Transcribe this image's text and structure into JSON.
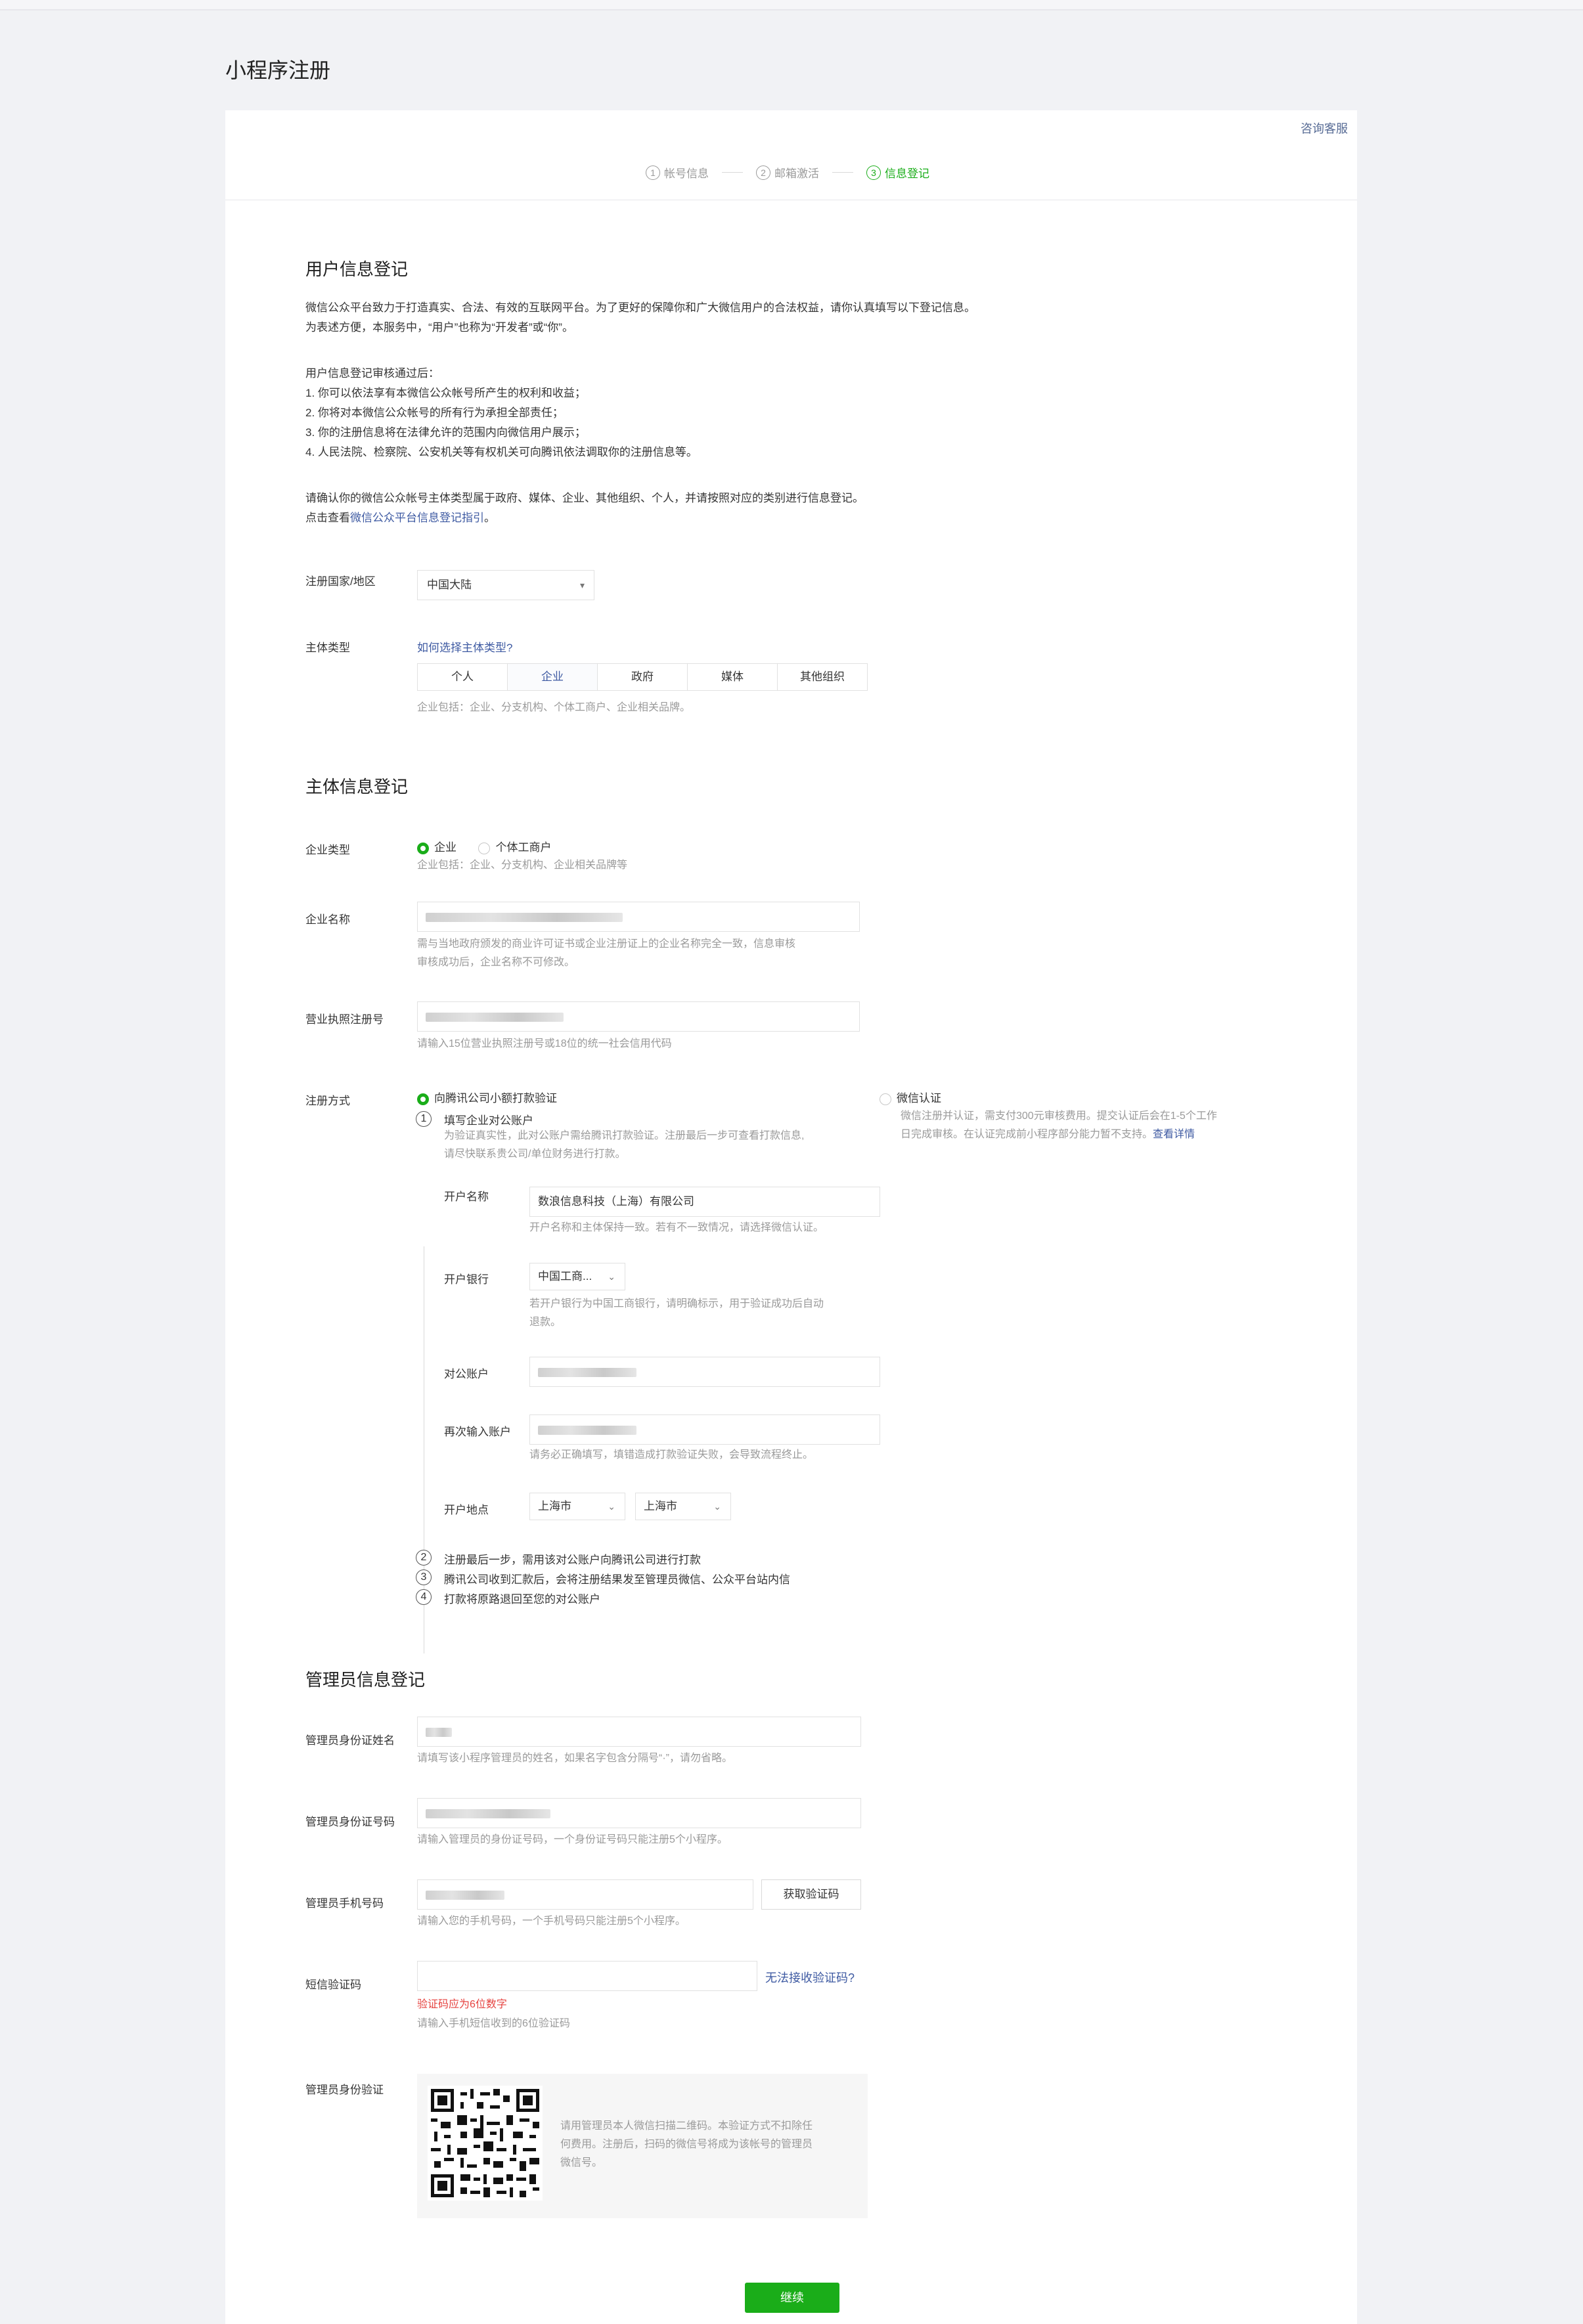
{
  "page_title": "小程序注册",
  "help_link": "咨询客服",
  "steps": [
    {
      "num": "1",
      "label": "帐号信息"
    },
    {
      "num": "2",
      "label": "邮箱激活"
    },
    {
      "num": "3",
      "label": "信息登记"
    }
  ],
  "user_info": {
    "title": "用户信息登记",
    "intro_1": "微信公众平台致力于打造真实、合法、有效的互联网平台。为了更好的保障你和广大微信用户的合法权益，请你认真填写以下登记信息。",
    "intro_2": "为表述方便，本服务中，“用户”也称为“开发者”或“你”。",
    "after_title": "用户信息登记审核通过后：",
    "after_items": [
      "1. 你可以依法享有本微信公众帐号所产生的权利和收益；",
      "2. 你将对本微信公众帐号的所有行为承担全部责任；",
      "3. 你的注册信息将在法律允许的范围内向微信用户展示；",
      "4. 人民法院、检察院、公安机关等有权机关可向腾讯依法调取你的注册信息等。"
    ],
    "confirm_text": "请确认你的微信公众帐号主体类型属于政府、媒体、企业、其他组织、个人，并请按照对应的类别进行信息登记。",
    "guide_prefix": "点击查看",
    "guide_link": "微信公众平台信息登记指引",
    "guide_suffix": "。",
    "country_label": "注册国家/地区",
    "country_value": "中国大陆",
    "subject_label": "主体类型",
    "subject_help": "如何选择主体类型?",
    "subject_types": [
      "个人",
      "企业",
      "政府",
      "媒体",
      "其他组织"
    ],
    "subject_hint": "企业包括：企业、分支机构、个体工商户、企业相关品牌。"
  },
  "subject_info": {
    "title": "主体信息登记",
    "company_type_label": "企业类型",
    "company_type_opt1": "企业",
    "company_type_opt2": "个体工商户",
    "company_type_hint": "企业包括：企业、分支机构、企业相关品牌等",
    "company_name_label": "企业名称",
    "company_name_hint_1": "需与当地政府颁发的商业许可证书或企业注册证上的企业名称完全一致，信息审核",
    "company_name_hint_2": "审核成功后，企业名称不可修改。",
    "license_label": "营业执照注册号",
    "license_hint": "请输入15位营业执照注册号或18位的统一社会信用代码",
    "reg_method_label": "注册方式",
    "method1": "向腾讯公司小额打款验证",
    "method2": "微信认证",
    "method2_desc_1": "微信注册并认证，需支付300元审核费用。提交认证后会在1-5个工作",
    "method2_desc_2": "日完成审核。在认证完成前小程序部分能力暂不支持。",
    "method2_link": "查看详情",
    "step1_num": "1",
    "step1_title": "填写企业对公账户",
    "step1_desc_1": "为验证真实性，此对公账户需给腾讯打款验证。注册最后一步可查看打款信息,",
    "step1_desc_2": "请尽快联系贵公司/单位财务进行打款。",
    "account_name_label": "开户名称",
    "account_name_value": "数浪信息科技（上海）有限公司",
    "account_name_hint": "开户名称和主体保持一致。若有不一致情况，请选择微信认证。",
    "bank_label": "开户银行",
    "bank_value": "中国工商...",
    "bank_hint_1": "若开户银行为中国工商银行，请明确标示，用于验证成功后自动",
    "bank_hint_2": "退款。",
    "account_label": "对公账户",
    "account_repeat_label": "再次输入账户",
    "account_repeat_hint": "请务必正确填写，填错造成打款验证失败，会导致流程终止。",
    "location_label": "开户地点",
    "province": "上海市",
    "city": "上海市",
    "step2_num": "2",
    "step2_text": "注册最后一步，需用该对公账户向腾讯公司进行打款",
    "step3_num": "3",
    "step3_text": "腾讯公司收到汇款后，会将注册结果发至管理员微信、公众平台站内信",
    "step4_num": "4",
    "step4_text": "打款将原路退回至您的对公账户"
  },
  "admin_info": {
    "title": "管理员信息登记",
    "name_label": "管理员身份证姓名",
    "name_hint": "请填写该小程序管理员的姓名，如果名字包含分隔号“·”，请勿省略。",
    "id_label": "管理员身份证号码",
    "id_hint": "请输入管理员的身份证号码，一个身份证号码只能注册5个小程序。",
    "phone_label": "管理员手机号码",
    "get_code_button": "获取验证码",
    "phone_hint": "请输入您的手机号码，一个手机号码只能注册5个小程序。",
    "sms_label": "短信验证码",
    "sms_help": "无法接收验证码?",
    "sms_error": "验证码应为6位数字",
    "sms_hint": "请输入手机短信收到的6位验证码",
    "verify_label": "管理员身份验证",
    "verify_desc_1": "请用管理员本人微信扫描二维码。本验证方式不扣除任",
    "verify_desc_2": "何费用。注册后，扫码的微信号将成为该帐号的管理员",
    "verify_desc_3": "微信号。"
  },
  "continue_button": "继续",
  "colors": {
    "accent_green": "#1aad19",
    "link_blue": "#576b95",
    "error_red": "#e64340"
  }
}
